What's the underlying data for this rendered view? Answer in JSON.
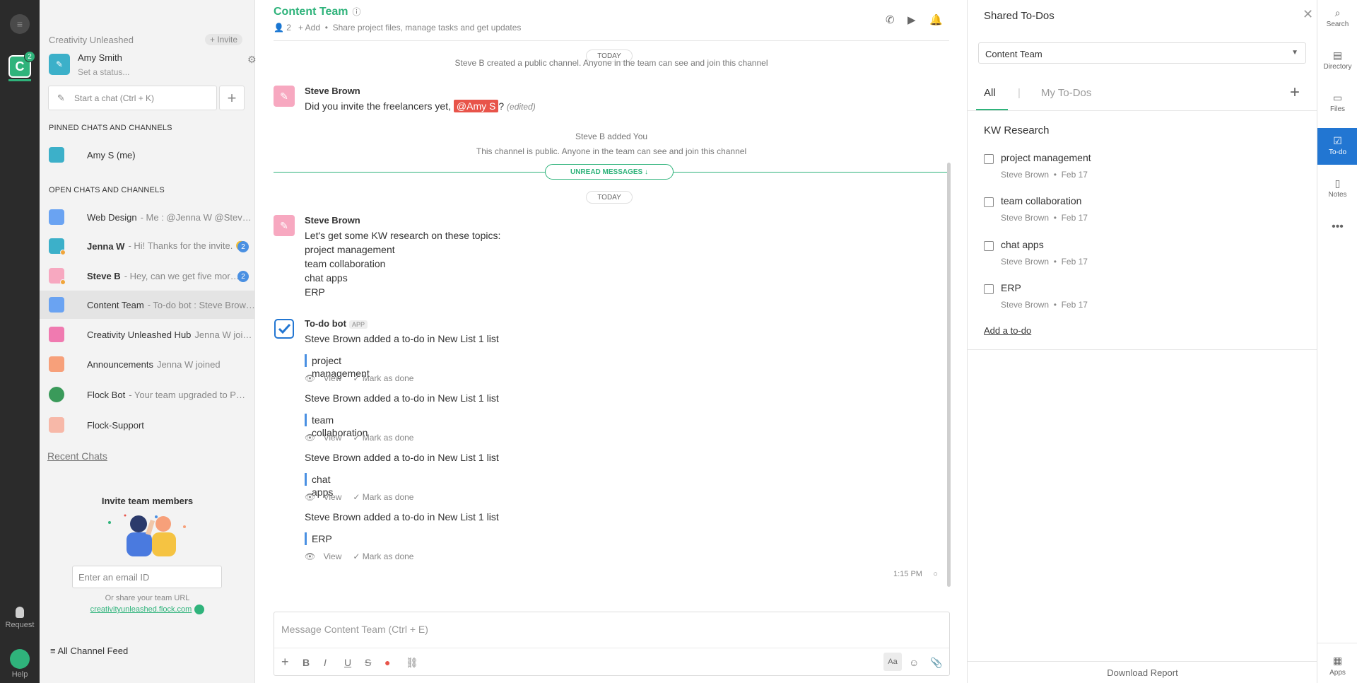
{
  "rail": {
    "team_badge": "2",
    "request_label": "Request",
    "help_label": "Help"
  },
  "sidebar": {
    "team_name": "Creativity Unleashed",
    "invite_label": "+ Invite",
    "user_name": "Amy Smith",
    "status_placeholder": "Set a status...",
    "start_chat_placeholder": "Start a chat (Ctrl + K)",
    "pinned_header": "PINNED CHATS AND CHANNELS",
    "pinned": [
      {
        "name": "Amy S (me)"
      }
    ],
    "open_header": "OPEN CHATS AND CHANNELS",
    "open": [
      {
        "name": "Web Design",
        "preview": "- Me : @Jenna W @Steve B ...",
        "color": "#6aa3f2"
      },
      {
        "name": "Jenna W",
        "preview": "- Hi! Thanks for the invite. 🙂",
        "count": "2",
        "color": "#3cb0c9"
      },
      {
        "name": "Steve B",
        "preview": "- Hey, can we get five more f...",
        "count": "2",
        "color": "#f7a8c0"
      },
      {
        "name": "Content Team",
        "preview": "- To-do bot : Steve Brown ...",
        "color": "#6aa3f2"
      },
      {
        "name": "Creativity Unleashed Hub",
        "preview": "Jenna W joined",
        "color": "#f07ab0"
      },
      {
        "name": "Announcements",
        "preview": "Jenna W joined",
        "color": "#f7a07a"
      },
      {
        "name": "Flock Bot",
        "preview": "- Your team upgraded to PRO",
        "color": "#3a9a5a"
      },
      {
        "name": "Flock-Support",
        "preview": "",
        "color": "#f7b8a8"
      }
    ],
    "recent_chats": "Recent Chats",
    "invite_header": "Invite team members",
    "email_placeholder": "Enter an email ID",
    "share_text": "Or share your team URL",
    "team_url": "creativityunleashed.flock.com",
    "channel_feed": "All Channel Feed"
  },
  "main": {
    "channel_title": "Content Team",
    "member_count": "2",
    "add_label": "+ Add",
    "description": "Share project files, manage tasks and get updates",
    "today1": "TODAY",
    "created_msg": "Steve B created a public channel. Anyone in the team can see and join this channel",
    "msg1_author": "Steve Brown",
    "msg1_text": "Did you invite the freelancers yet,",
    "msg1_mention": "@Amy S",
    "msg1_tail": "?",
    "msg1_edited": "(edited)",
    "added_msg": "Steve B added You",
    "public_msg": "This channel is public. Anyone in the team can see and join this channel",
    "unread_label": "UNREAD MESSAGES ↓",
    "today2": "TODAY",
    "msg2_author": "Steve Brown",
    "msg2_lines": [
      "Let's get some KW research on these topics:",
      "project management",
      "team collaboration",
      "chat apps",
      "ERP"
    ],
    "bot_name": "To-do bot",
    "bot_badge": "APP",
    "bot_added_text": "Steve Brown added a to-do in New List 1 list",
    "bot_items": [
      "project management",
      "team collaboration",
      "chat apps",
      "ERP"
    ],
    "view_label": "View",
    "done_label": "Mark as done",
    "time": "1:15 PM",
    "composer_placeholder": "Message Content Team (Ctrl + E)",
    "aa_label": "Aa"
  },
  "todo": {
    "title": "Shared To-Dos",
    "selected_team": "Content Team",
    "tab_all": "All",
    "tab_sep": "|",
    "tab_mine": "My To-Dos",
    "list_name": "KW Research",
    "items": [
      {
        "text": "project management",
        "author": "Steve Brown",
        "date": "Feb 17"
      },
      {
        "text": "team collaboration",
        "author": "Steve Brown",
        "date": "Feb 17"
      },
      {
        "text": "chat apps",
        "author": "Steve Brown",
        "date": "Feb 17"
      },
      {
        "text": "ERP",
        "author": "Steve Brown",
        "date": "Feb 17"
      }
    ],
    "add_todo": "Add a to-do",
    "download": "Download Report"
  },
  "right_rail": {
    "search": "Search",
    "directory": "Directory",
    "files": "Files",
    "todo": "To-do",
    "notes": "Notes",
    "apps": "Apps"
  }
}
